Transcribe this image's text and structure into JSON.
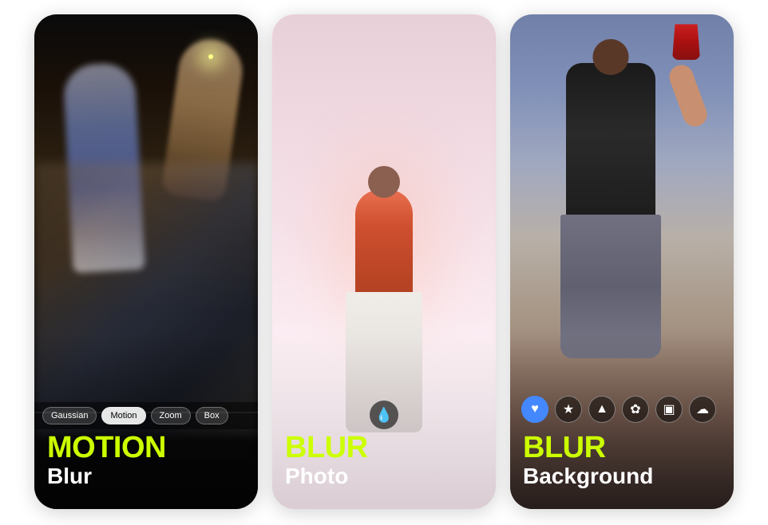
{
  "cards": [
    {
      "id": "card-1",
      "title": "MOTION",
      "subtitle": "Blur",
      "filters": [
        {
          "label": "Gaussian",
          "active": false
        },
        {
          "label": "Motion",
          "active": true
        },
        {
          "label": "Zoom",
          "active": false
        },
        {
          "label": "Box",
          "active": false
        }
      ],
      "theme": "dark"
    },
    {
      "id": "card-2",
      "title": "BLUR",
      "subtitle": "Photo",
      "drop_icon": "💧",
      "theme": "light-pink"
    },
    {
      "id": "card-3",
      "title": "BLUR",
      "subtitle": "Background",
      "icons": [
        {
          "type": "heart",
          "symbol": "♥",
          "style": "filled-blue"
        },
        {
          "type": "star",
          "symbol": "★",
          "style": "outline"
        },
        {
          "type": "triangle",
          "symbol": "▲",
          "style": "outline"
        },
        {
          "type": "gamepad",
          "symbol": "✿",
          "style": "outline"
        },
        {
          "type": "square",
          "symbol": "⬡",
          "style": "outline"
        },
        {
          "type": "cloud",
          "symbol": "☁",
          "style": "outline"
        }
      ],
      "theme": "dark-party"
    }
  ]
}
